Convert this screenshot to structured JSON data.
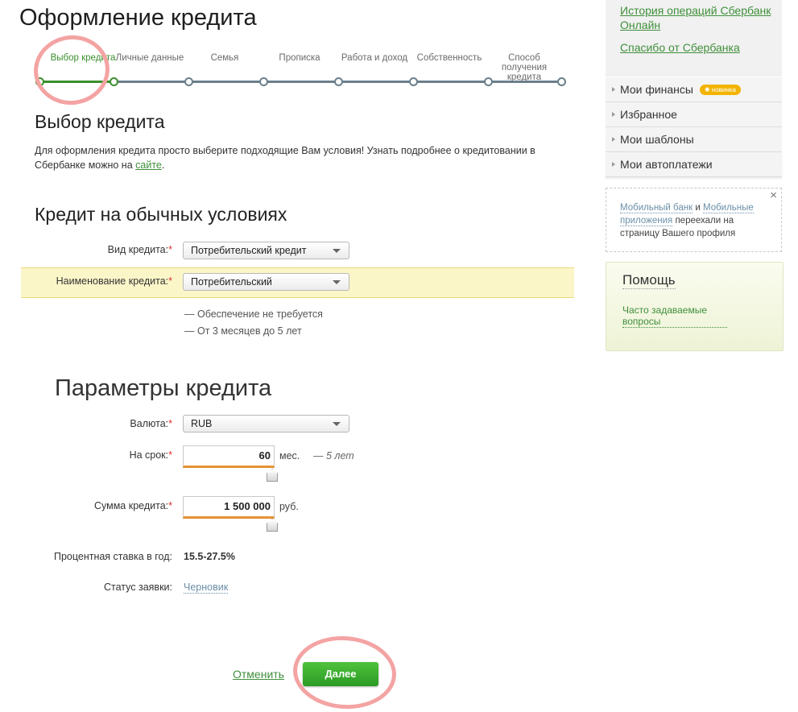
{
  "page": {
    "title": "Оформление кредита"
  },
  "stepper": {
    "steps": [
      {
        "label": "Выбор кредита",
        "active": true
      },
      {
        "label": "Личные данные",
        "active": false
      },
      {
        "label": "Семья",
        "active": false
      },
      {
        "label": "Прописка",
        "active": false
      },
      {
        "label": "Работа и доход",
        "active": false
      },
      {
        "label": "Собственность",
        "active": false
      },
      {
        "label": "Способ получения кредита",
        "active": false
      }
    ]
  },
  "choice": {
    "heading": "Выбор кредита",
    "description": "Для оформления кредита просто выберите подходящие Вам условия! Узнать подробнее о кредитовании в Сбербанке можно на",
    "link": "сайте",
    "period": "."
  },
  "ordinary": {
    "heading": "Кредит на обычных условиях",
    "type_label": "Вид кредита:",
    "type_value": "Потребительский кредит",
    "name_label": "Наименование кредита:",
    "name_value": "Потребительский",
    "notes": [
      "— Обеспечение не требуется",
      "— От 3 месяцев до 5 лет"
    ],
    "required_mark": "*"
  },
  "params": {
    "heading": "Параметры кредита",
    "currency_label": "Валюта:",
    "currency_value": "RUB",
    "term_label": "На срок:",
    "term_value": "60",
    "term_unit": "мес.",
    "term_hint": "— 5 лет",
    "amount_label": "Сумма кредита:",
    "amount_value": "1 500 000",
    "amount_unit": "руб.",
    "rate_label": "Процентная ставка в год:",
    "rate_value": "15.5-27.5%",
    "status_label": "Статус заявки:",
    "status_value": "Черновик"
  },
  "actions": {
    "cancel": "Отменить",
    "next": "Далее"
  },
  "sidebar": {
    "links": [
      "История операций Сбербанк Онлайн",
      "Спасибо от Сбербанка"
    ],
    "menu": [
      {
        "label": "Мои финансы",
        "badge": "новинка"
      },
      {
        "label": "Избранное"
      },
      {
        "label": "Мои шаблоны"
      },
      {
        "label": "Мои автоплатежи"
      }
    ],
    "notice": {
      "link1": "Мобильный банк",
      "and": " и ",
      "link2": "Мобильные приложения",
      "text": " переехали на страницу Вашего профиля",
      "close": "×"
    },
    "help": {
      "title": "Помощь",
      "faq": "Часто задаваемые вопросы"
    }
  },
  "colors": {
    "accent": "#3a8f2d",
    "link": "#3f8f3a",
    "annotation": "#f4a3a3",
    "highlight": "#fbf6c8"
  }
}
